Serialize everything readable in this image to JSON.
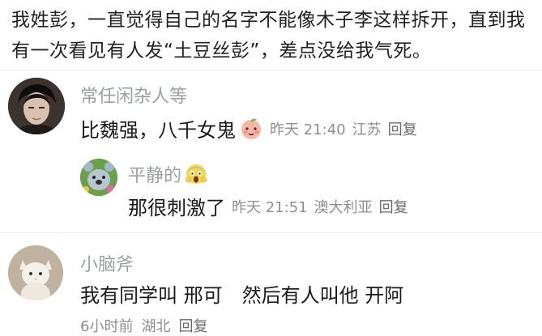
{
  "post": {
    "text": "我姓彭，一直觉得自己的名字不能像木子李这样拆开，直到我有一次看见有人发“土豆丝彭”，差点没给我气死。"
  },
  "comments": [
    {
      "username": "常任闲杂人等",
      "text": "比魏强，八千女鬼",
      "emoji_icon": "peach-face-emoji-icon",
      "time": "昨天 21:40",
      "location": "江苏",
      "reply_label": "回复",
      "replies": [
        {
          "username": "平静的",
          "emoji_icon": "screaming-face-emoji-icon",
          "text": "那很刺激了",
          "time": "昨天 21:51",
          "location": "澳大利亚",
          "reply_label": "回复"
        }
      ]
    },
    {
      "username": "小脑斧",
      "text": "我有同学叫 邢可　然后有人叫他 开阿",
      "time": "6小时前",
      "location": "湖北",
      "reply_label": "回复"
    }
  ]
}
